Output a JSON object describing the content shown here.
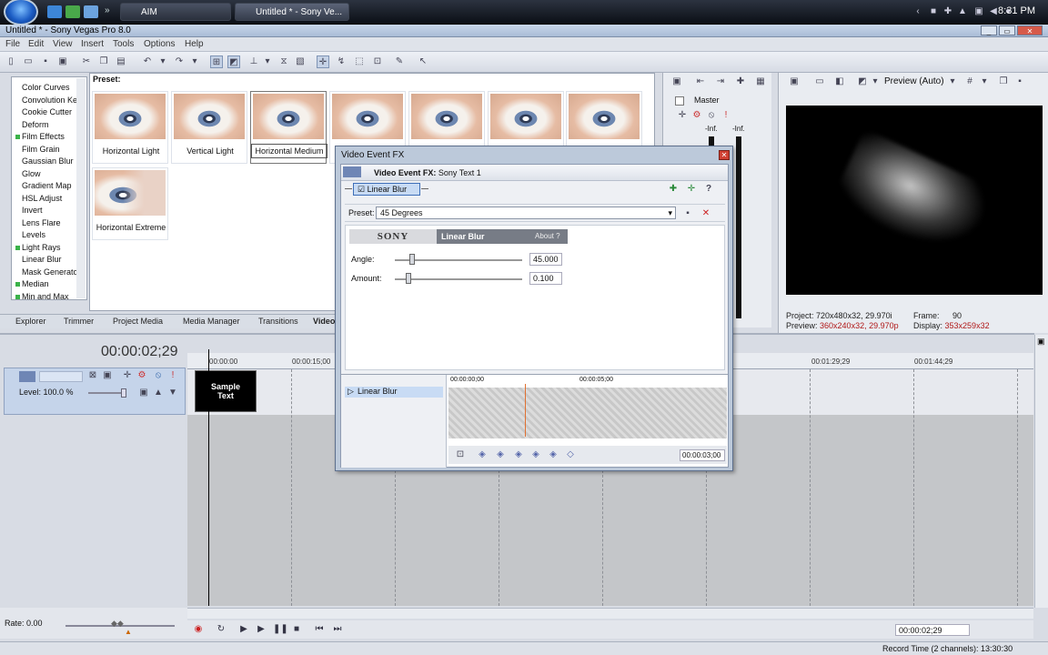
{
  "taskbar": {
    "tasks": [
      "AIM",
      "Untitled * - Sony Ve..."
    ],
    "clock": "8:31 PM"
  },
  "app": {
    "title": "Untitled * - Sony Vegas Pro 8.0"
  },
  "menu": [
    "File",
    "Edit",
    "View",
    "Insert",
    "Tools",
    "Options",
    "Help"
  ],
  "fx_list": [
    {
      "label": "Color Curves",
      "green": false
    },
    {
      "label": "Convolution Ke",
      "green": false
    },
    {
      "label": "Cookie Cutter",
      "green": false
    },
    {
      "label": "Deform",
      "green": false
    },
    {
      "label": "Film Effects",
      "green": true
    },
    {
      "label": "Film Grain",
      "green": false
    },
    {
      "label": "Gaussian Blur",
      "green": false
    },
    {
      "label": "Glow",
      "green": false
    },
    {
      "label": "Gradient Map",
      "green": false
    },
    {
      "label": "HSL Adjust",
      "green": false
    },
    {
      "label": "Invert",
      "green": false
    },
    {
      "label": "Lens Flare",
      "green": false
    },
    {
      "label": "Levels",
      "green": false
    },
    {
      "label": "Light Rays",
      "green": true
    },
    {
      "label": "Linear Blur",
      "green": false
    },
    {
      "label": "Mask Generato",
      "green": false
    },
    {
      "label": "Median",
      "green": true
    },
    {
      "label": "Min and Max",
      "green": true
    }
  ],
  "presets_panel": {
    "label": "Preset:",
    "items": [
      "Horizontal Light",
      "Vertical Light",
      "Horizontal Medium",
      "Horizontal Extreme"
    ]
  },
  "tabs": [
    "Explorer",
    "Trimmer",
    "Project Media",
    "Media Manager",
    "Transitions",
    "Video"
  ],
  "mixer": {
    "master": "Master",
    "inf_left": "-Inf.",
    "inf_right": "-Inf."
  },
  "preview": {
    "mode": "Preview (Auto)",
    "project_label": "Project:",
    "project_value": "720x480x32, 29.970i",
    "preview_label": "Preview:",
    "preview_value": "360x240x32, 29.970p",
    "frame_label": "Frame:",
    "frame_value": "90",
    "display_label": "Display:",
    "display_value": "353x259x32"
  },
  "timeline": {
    "timecode": "00:00:02;29",
    "ruler": [
      "00:00:00",
      "00:00:15;00",
      "00:01:29;29",
      "00:01:44;29"
    ],
    "track_level": "Level: 100.0 %",
    "event_text_line1": "Sample",
    "event_text_line2": "Text",
    "rate": "Rate: 0.00",
    "end_timecode": "00:00:02;29",
    "record_time": "Record Time (2 channels): 13:30:30"
  },
  "dialog": {
    "title": "Video Event FX",
    "header_label": "Video Event FX:",
    "header_value": "Sony Text 1",
    "chain_item": "Linear Blur",
    "preset_label": "Preset:",
    "preset_value": "45 Degrees",
    "sony_logo": "SONY",
    "fx_name": "Linear Blur",
    "about": "About  ?",
    "angle_label": "Angle:",
    "angle_value": "45.000",
    "amount_label": "Amount:",
    "amount_value": "0.100",
    "kf_label": "Linear Blur",
    "kf_start": "00:00:00;00",
    "kf_mid": "00:00:05;00",
    "kf_end": "00:00:03;00"
  }
}
